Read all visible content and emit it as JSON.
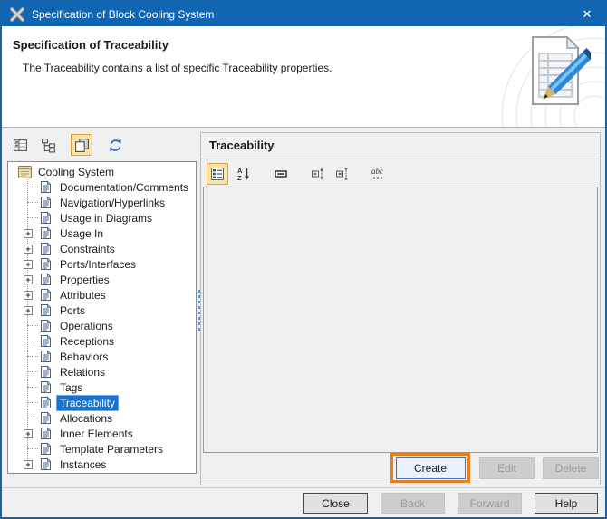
{
  "window": {
    "title": "Specification of Block Cooling System",
    "app_icon": "magicdraw-logo",
    "close_icon": "✕"
  },
  "header": {
    "title": "Specification of Traceability",
    "description": "The Traceability contains a list of specific Traceability properties.",
    "icon": "document-pencil-icon"
  },
  "left_toolbar": {
    "icons": [
      {
        "name": "properties-view-icon",
        "selected": false
      },
      {
        "name": "tree-view-icon",
        "selected": false
      },
      {
        "name": "cascade-view-icon",
        "selected": true
      },
      {
        "name": "refresh-icon",
        "selected": false
      }
    ]
  },
  "tree": {
    "items": [
      {
        "label": "Cooling System",
        "type": "root",
        "expandable": false,
        "selected": false
      },
      {
        "label": "Documentation/Comments",
        "type": "child",
        "expandable": false,
        "selected": false
      },
      {
        "label": "Navigation/Hyperlinks",
        "type": "child",
        "expandable": false,
        "selected": false
      },
      {
        "label": "Usage in Diagrams",
        "type": "child",
        "expandable": false,
        "selected": false
      },
      {
        "label": "Usage In",
        "type": "child",
        "expandable": true,
        "selected": false
      },
      {
        "label": "Constraints",
        "type": "child",
        "expandable": true,
        "selected": false
      },
      {
        "label": "Ports/Interfaces",
        "type": "child",
        "expandable": true,
        "selected": false
      },
      {
        "label": "Properties",
        "type": "child",
        "expandable": true,
        "selected": false
      },
      {
        "label": "Attributes",
        "type": "child",
        "expandable": true,
        "selected": false
      },
      {
        "label": "Ports",
        "type": "child",
        "expandable": true,
        "selected": false
      },
      {
        "label": "Operations",
        "type": "child",
        "expandable": false,
        "selected": false
      },
      {
        "label": "Receptions",
        "type": "child",
        "expandable": false,
        "selected": false
      },
      {
        "label": "Behaviors",
        "type": "child",
        "expandable": false,
        "selected": false
      },
      {
        "label": "Relations",
        "type": "child",
        "expandable": false,
        "selected": false
      },
      {
        "label": "Tags",
        "type": "child",
        "expandable": false,
        "selected": false
      },
      {
        "label": "Traceability",
        "type": "child",
        "expandable": false,
        "selected": true
      },
      {
        "label": "Allocations",
        "type": "child",
        "expandable": false,
        "selected": false
      },
      {
        "label": "Inner Elements",
        "type": "child",
        "expandable": true,
        "selected": false
      },
      {
        "label": "Template Parameters",
        "type": "child",
        "expandable": false,
        "selected": false
      },
      {
        "label": "Instances",
        "type": "child",
        "expandable": true,
        "selected": false
      }
    ]
  },
  "right_panel": {
    "title": "Traceability",
    "toolbar": [
      {
        "name": "categorized-view-icon",
        "selected": true
      },
      {
        "name": "sort-alphabetically-icon",
        "selected": false
      },
      {
        "name": "show-fields-icon",
        "selected": false
      },
      {
        "name": "expand-nodes-icon",
        "selected": false
      },
      {
        "name": "collapse-nodes-icon",
        "selected": false
      },
      {
        "name": "filter-properties-icon",
        "selected": false
      }
    ],
    "buttons": [
      {
        "label": "Create",
        "enabled": true,
        "highlighted": true
      },
      {
        "label": "Edit",
        "enabled": false,
        "highlighted": false
      },
      {
        "label": "Delete",
        "enabled": false,
        "highlighted": false
      }
    ]
  },
  "footer": {
    "buttons": [
      {
        "label": "Close",
        "enabled": true
      },
      {
        "label": "Back",
        "enabled": false
      },
      {
        "label": "Forward",
        "enabled": false
      },
      {
        "label": "Help",
        "enabled": true
      }
    ]
  },
  "colors": {
    "titlebar": "#1166b4",
    "dialog_border": "#1565ae",
    "selection": "#1673d1",
    "highlight_ring": "#e87d1f",
    "toolbar_selected_bg": "#fbe3a7",
    "toolbar_selected_border": "#d9a449"
  }
}
